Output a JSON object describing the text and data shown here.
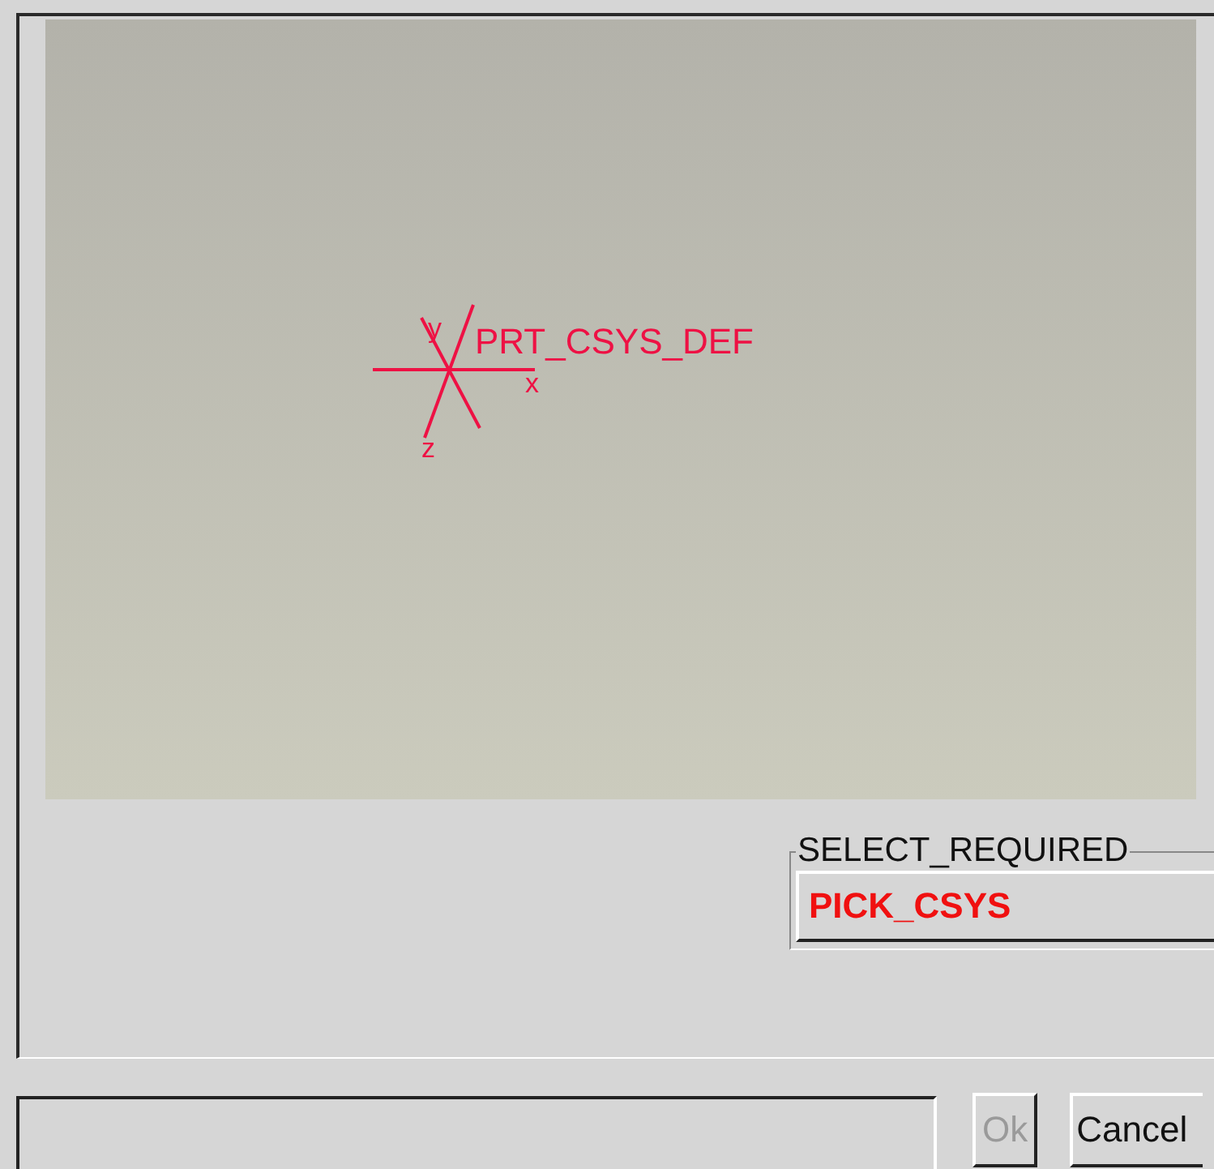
{
  "viewport": {
    "csys": {
      "name": "PRT_CSYS_DEF",
      "axes": [
        {
          "label": "x"
        },
        {
          "label": "y"
        },
        {
          "label": "z"
        }
      ]
    }
  },
  "select_group": {
    "title": "SELECT_REQUIRED",
    "prompt": "PICK_CSYS"
  },
  "buttons": [
    {
      "label": "Ok",
      "disabled": true
    },
    {
      "label": "Cancel",
      "disabled": false
    }
  ]
}
